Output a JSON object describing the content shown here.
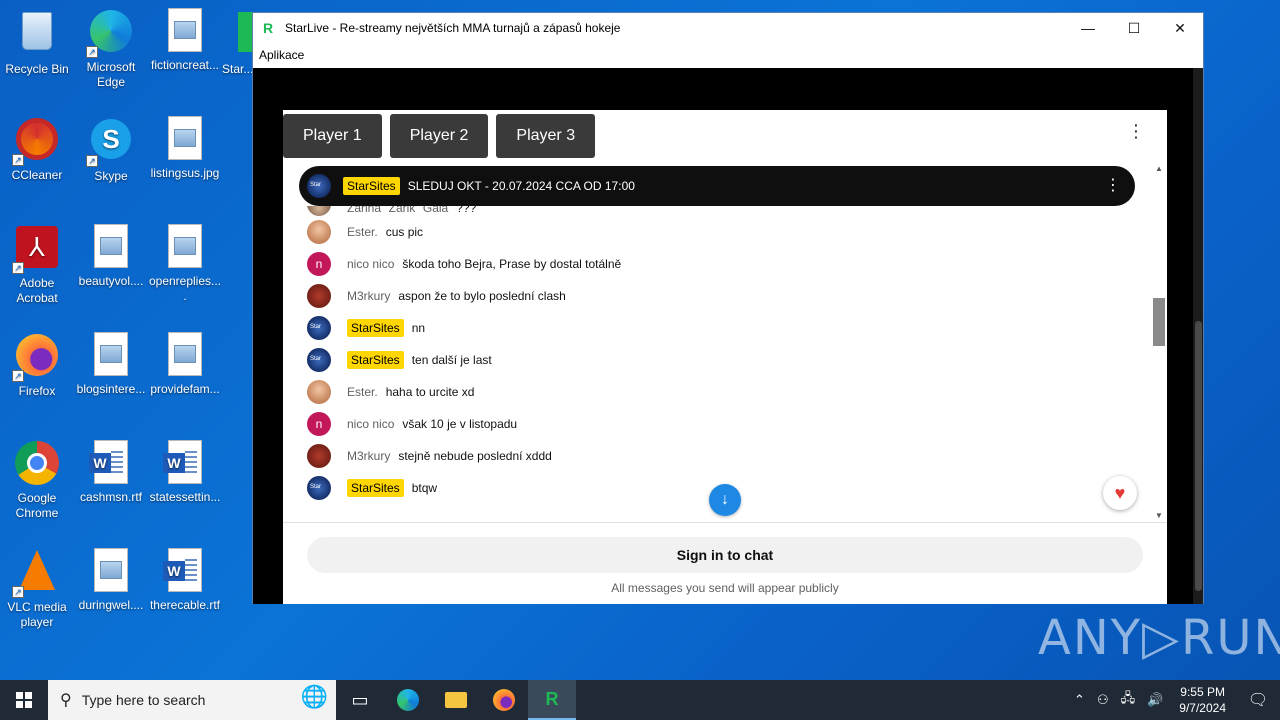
{
  "desktop": {
    "icons": [
      {
        "label": "Recycle Bin"
      },
      {
        "label": "Microsoft Edge"
      },
      {
        "label": "fictioncreat..."
      },
      {
        "label": "Star..."
      },
      {
        "label": "CCleaner"
      },
      {
        "label": "Skype"
      },
      {
        "label": "listingsus.jpg"
      },
      {
        "label": "Adobe Acrobat"
      },
      {
        "label": "beautyvol...."
      },
      {
        "label": "openreplies...."
      },
      {
        "label": "Firefox"
      },
      {
        "label": "blogsintere..."
      },
      {
        "label": "providefam..."
      },
      {
        "label": "Google Chrome"
      },
      {
        "label": "cashmsn.rtf"
      },
      {
        "label": "statessettin..."
      },
      {
        "label": "VLC media player"
      },
      {
        "label": "duringwel...."
      },
      {
        "label": "therecable.rtf"
      }
    ]
  },
  "window": {
    "title": "StarLive - Re-streamy největších MMA turnajů a zápasů hokeje",
    "menu": "Aplikace",
    "controls": {
      "minimize": "—",
      "maximize": "☐",
      "close": "✕"
    }
  },
  "players": [
    "Player 1",
    "Player 2",
    "Player 3"
  ],
  "pinned": {
    "badge": "StarSites",
    "message": "SLEDUJ OKT - 20.07.2024 CCA OD 17:00"
  },
  "chat": [
    {
      "author": "Zarina \"Zarik\" Gala",
      "text": "???",
      "badge": false,
      "avatar": "zarina"
    },
    {
      "author": "Ester.",
      "text": "cus pic",
      "badge": false,
      "avatar": "ester"
    },
    {
      "author": "nico nico",
      "text": "škoda toho Bejra, Prase by dostal totálně",
      "badge": false,
      "avatar": "nico"
    },
    {
      "author": "M3rkury",
      "text": "aspon že to bylo poslední clash",
      "badge": false,
      "avatar": "m3"
    },
    {
      "author": "StarSites",
      "text": "nn",
      "badge": true,
      "avatar": "star"
    },
    {
      "author": "StarSites",
      "text": "ten další je last",
      "badge": true,
      "avatar": "star"
    },
    {
      "author": "Ester.",
      "text": "haha to urcite xd",
      "badge": false,
      "avatar": "ester"
    },
    {
      "author": "nico nico",
      "text": "však 10 je v listopadu",
      "badge": false,
      "avatar": "nico"
    },
    {
      "author": "M3rkury",
      "text": "stejně nebude poslední xddd",
      "badge": false,
      "avatar": "m3"
    },
    {
      "author": "StarSites",
      "text": "btqw",
      "badge": true,
      "avatar": "star"
    }
  ],
  "footer": {
    "sign_in": "Sign in to chat",
    "note": "All messages you send will appear publicly"
  },
  "nico_initial": "n",
  "watermark": "ANY▷RUN",
  "taskbar": {
    "search_placeholder": "Type here to search",
    "time": "9:55 PM",
    "date": "9/7/2024"
  },
  "colors": {
    "badge": "#ffd600",
    "scroll_button": "#1e88e5",
    "heart": "#e53935"
  }
}
